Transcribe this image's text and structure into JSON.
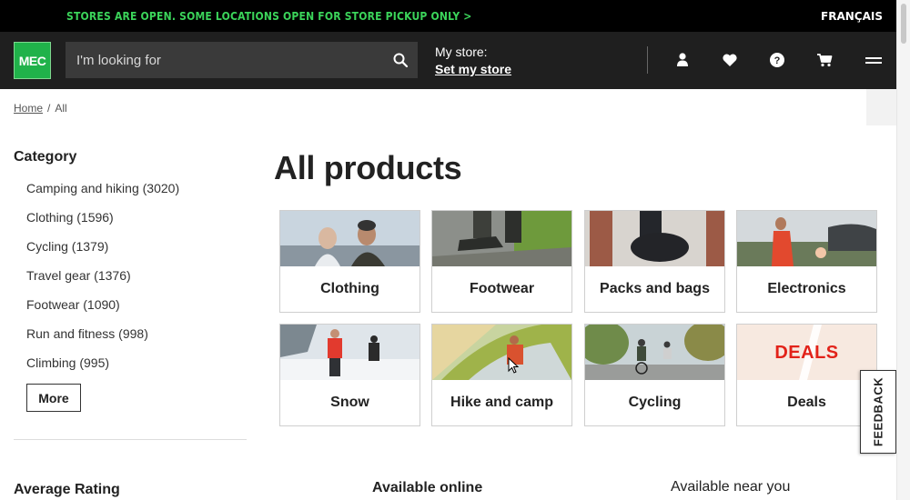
{
  "announcement": {
    "text": "STORES ARE OPEN. SOME LOCATIONS OPEN FOR STORE PICKUP ONLY >",
    "language_link": "FRANÇAIS"
  },
  "header": {
    "logo_text": "MEC",
    "search_placeholder": "I'm looking for",
    "my_store_label": "My store:",
    "set_store_link": "Set my store",
    "icons": [
      "user-icon",
      "heart-icon",
      "help-icon",
      "cart-icon",
      "menu-icon"
    ]
  },
  "breadcrumb": {
    "home": "Home",
    "separator": "/",
    "current": "All"
  },
  "sidebar": {
    "category_title": "Category",
    "categories": [
      "Camping and hiking (3020)",
      "Clothing (1596)",
      "Cycling (1379)",
      "Travel gear (1376)",
      "Footwear (1090)",
      "Run and fitness (998)",
      "Climbing (995)"
    ],
    "more_button": "More",
    "rating_title": "Average Rating"
  },
  "main": {
    "title": "All products",
    "tiles": [
      {
        "label": "Clothing"
      },
      {
        "label": "Footwear"
      },
      {
        "label": "Packs and bags"
      },
      {
        "label": "Electronics"
      },
      {
        "label": "Snow"
      },
      {
        "label": "Hike and camp"
      },
      {
        "label": "Cycling"
      },
      {
        "label": "Deals",
        "image_text": "DEALS"
      }
    ],
    "available_online": "Available online",
    "available_near": "Available near you"
  },
  "feedback_tab": "FEEDBACK",
  "colors": {
    "brand_green": "#20b24a",
    "promo_green": "#3bd45a",
    "header_bg": "#1f1f1f",
    "deals_red": "#e2231a"
  }
}
